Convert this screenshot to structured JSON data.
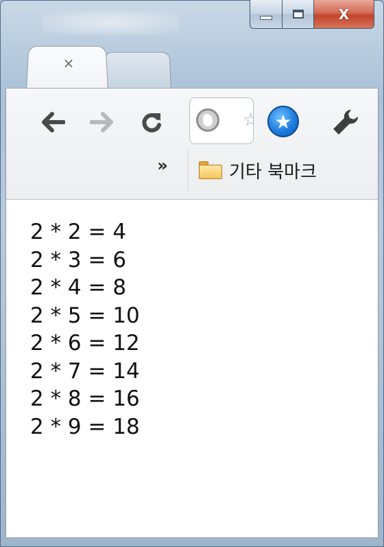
{
  "window": {
    "caption_buttons": {
      "minimize_icon": "minimize-icon",
      "maximize_icon": "maximize-icon",
      "close_glyph": "X"
    }
  },
  "tabs": [
    {
      "close_glyph": "×",
      "active": true
    },
    {
      "active": false
    }
  ],
  "toolbar": {
    "back_glyph": "🡐",
    "forward_glyph": "🡒",
    "reload_glyph": "C",
    "star_glyph": "☆",
    "extension_glyph": "★",
    "overflow_glyph": "»"
  },
  "bookmarks": {
    "folder_label": "기타 북마크"
  },
  "content": {
    "lines": [
      "2 * 2 = 4",
      "2 * 3 = 6",
      "2 * 4 = 8",
      "2 * 5 = 10",
      "2 * 6 = 12",
      "2 * 7 = 14",
      "2 * 8 = 16",
      "2 * 9 = 18"
    ]
  },
  "colors": {
    "frame": "#a9c0d6",
    "close_button": "#c0442c",
    "extension_blue": "#1f7ee0",
    "folder": "#f6c65c"
  }
}
